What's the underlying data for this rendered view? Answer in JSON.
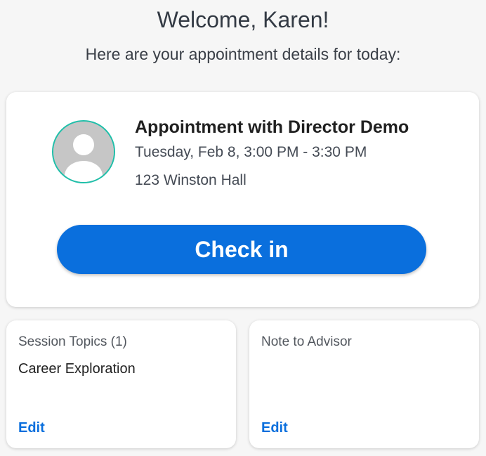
{
  "header": {
    "welcome": "Welcome, Karen!",
    "subtitle": "Here are your appointment details for today:"
  },
  "appointment": {
    "avatar_icon": "person-avatar-icon",
    "title": "Appointment with Director Demo",
    "time": "Tuesday, Feb 8, 3:00 PM - 3:30 PM",
    "location": "123 Winston Hall",
    "checkin_label": "Check in"
  },
  "session_topics": {
    "label": "Session Topics (1)",
    "value": "Career Exploration",
    "edit_label": "Edit"
  },
  "note_to_advisor": {
    "label": "Note to Advisor",
    "value": "",
    "edit_label": "Edit"
  },
  "colors": {
    "accent": "#0a6fdd",
    "avatar_ring": "#1fbfa9",
    "background": "#f6f6f6"
  }
}
